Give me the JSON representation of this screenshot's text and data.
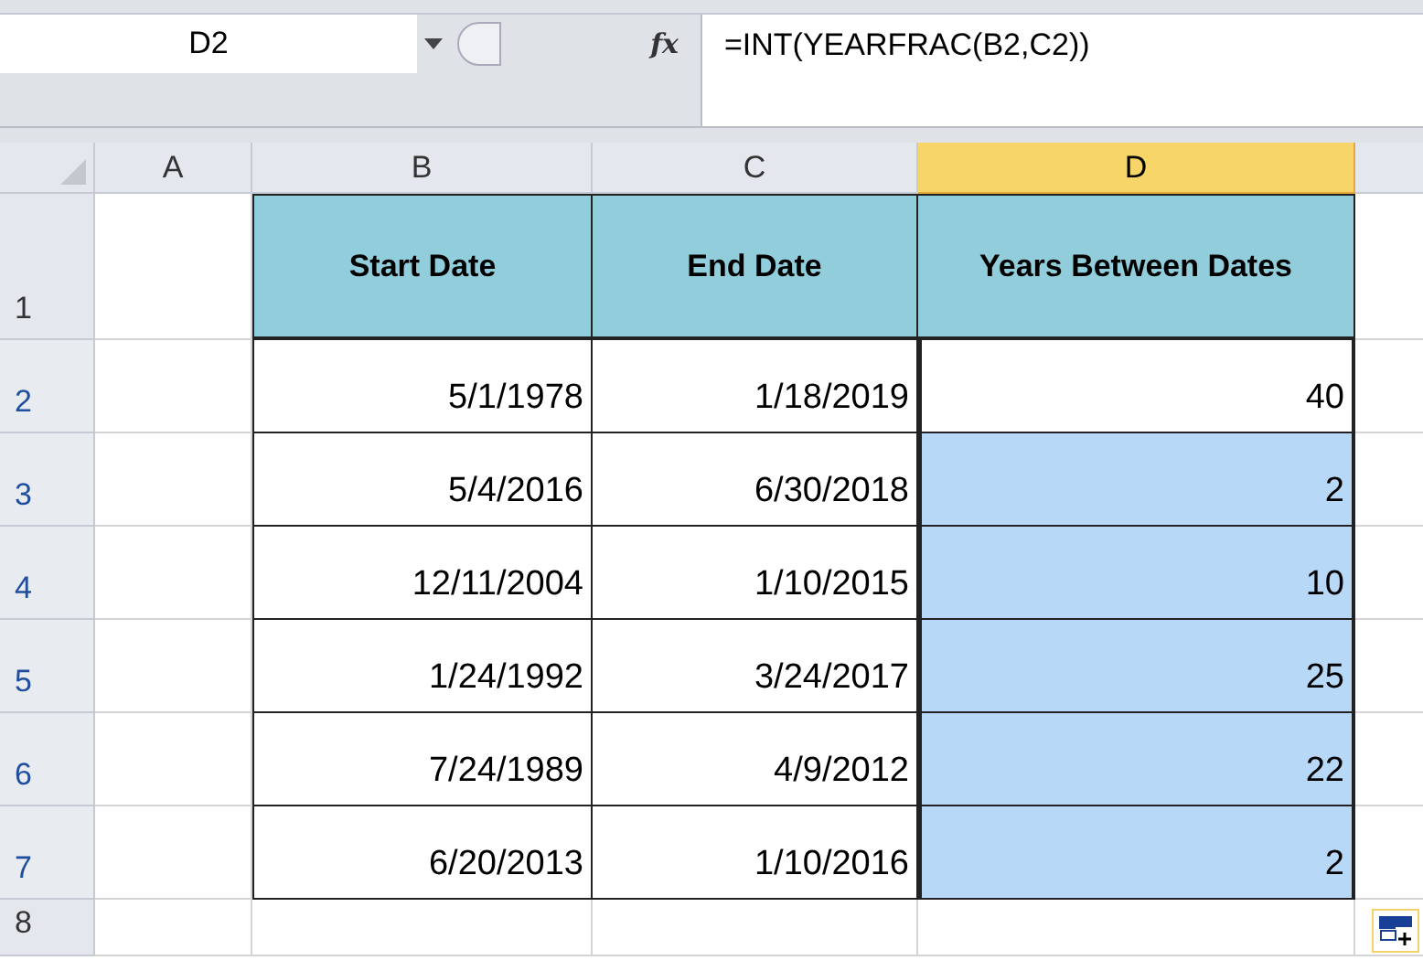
{
  "name_box": "D2",
  "formula_bar": {
    "fx": "fx",
    "formula": "=INT(YEARFRAC(B2,C2))"
  },
  "columns": [
    {
      "label": "A",
      "selected": false
    },
    {
      "label": "B",
      "selected": false
    },
    {
      "label": "C",
      "selected": false
    },
    {
      "label": "D",
      "selected": true
    }
  ],
  "header_row": {
    "row": "1",
    "selected": false,
    "cells": [
      "Start Date",
      "End Date",
      "Years Between Dates"
    ]
  },
  "rows": [
    {
      "row": "2",
      "selected": true,
      "active": true,
      "cells": [
        "5/1/1978",
        "1/18/2019",
        "40"
      ]
    },
    {
      "row": "3",
      "selected": true,
      "active": false,
      "cells": [
        "5/4/2016",
        "6/30/2018",
        "2"
      ]
    },
    {
      "row": "4",
      "selected": true,
      "active": false,
      "cells": [
        "12/11/2004",
        "1/10/2015",
        "10"
      ]
    },
    {
      "row": "5",
      "selected": true,
      "active": false,
      "cells": [
        "1/24/1992",
        "3/24/2017",
        "25"
      ]
    },
    {
      "row": "6",
      "selected": true,
      "active": false,
      "cells": [
        "7/24/1989",
        "4/9/2012",
        "22"
      ]
    },
    {
      "row": "7",
      "selected": true,
      "active": false,
      "cells": [
        "6/20/2013",
        "1/10/2016",
        "2"
      ]
    }
  ],
  "empty_row": {
    "row": "8",
    "selected": false
  }
}
